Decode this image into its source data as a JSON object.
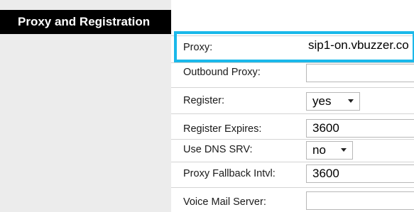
{
  "section": {
    "title": "Proxy and Registration"
  },
  "fields": {
    "proxy": {
      "label": "Proxy:",
      "value": "sip1-on.vbuzzer.co"
    },
    "outbound_proxy": {
      "label": "Outbound Proxy:",
      "value": ""
    },
    "register": {
      "label": "Register:",
      "value": "yes"
    },
    "register_expires": {
      "label": "Register Expires:",
      "value": "3600"
    },
    "use_dns_srv": {
      "label": "Use DNS SRV:",
      "value": "no"
    },
    "proxy_fallback_intvl": {
      "label": "Proxy Fallback Intvl:",
      "value": "3600"
    },
    "voice_mail_server": {
      "label": "Voice Mail Server:",
      "value": ""
    }
  },
  "colors": {
    "header_bg": "#000000",
    "panel_bg": "#ececec",
    "highlight": "#1ab8ea"
  }
}
